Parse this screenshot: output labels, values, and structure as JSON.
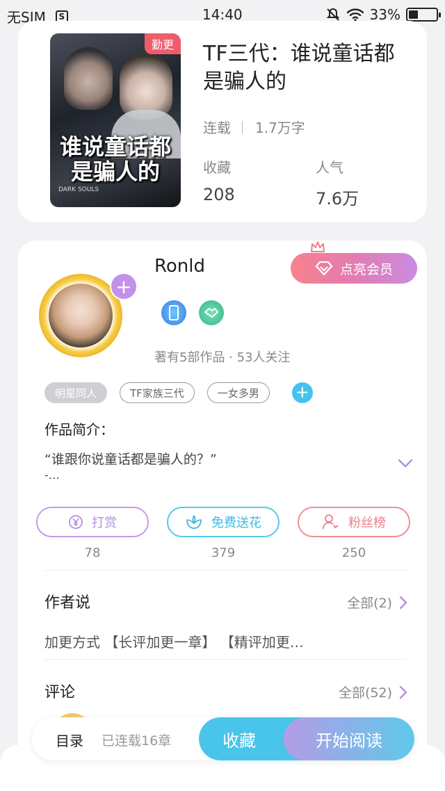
{
  "status_bar": {
    "carrier": "无SIM",
    "s_icon": "S",
    "time": "14:40",
    "battery": "33%",
    "battery_level": 0.33
  },
  "book": {
    "badge": "勤更",
    "cover_title": "谁说童话都是骗人的",
    "cover_sub": "DARK SOULS",
    "title": "TF三代：谁说童话都是骗人的",
    "status": "连载",
    "word_count": "1.7万字",
    "favorites_label": "收藏",
    "favorites_value": "208",
    "popularity_label": "人气",
    "popularity_value": "7.6万"
  },
  "author": {
    "name": "Ronld",
    "vip_button": "点亮会员",
    "stats": "著有5部作品 · 53人关注",
    "tags": [
      "明星同人",
      "TF家族三代",
      "一女多男"
    ],
    "intro_label": "作品简介：",
    "intro_text": "“谁跟你说童话都是骗人的？”",
    "intro_more": "-…"
  },
  "actions": [
    {
      "label": "打赏",
      "count": "78"
    },
    {
      "label": "免费送花",
      "count": "379"
    },
    {
      "label": "粉丝榜",
      "count": "250"
    }
  ],
  "author_says": {
    "title": "作者说",
    "link": "全部(2)",
    "text": "加更方式 【长评加更一章】 【精评加更…"
  },
  "comments": {
    "title": "评论",
    "link": "全部(52)"
  },
  "bottom_bar": {
    "toc": "目录",
    "progress": "已连载16章",
    "favorite": "收藏",
    "read": "开始阅读"
  }
}
